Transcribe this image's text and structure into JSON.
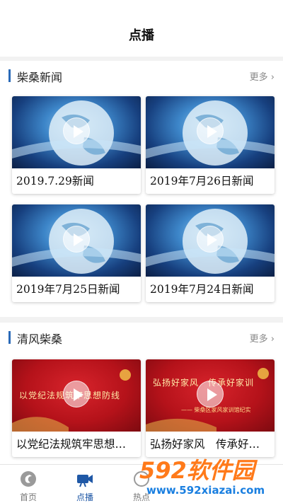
{
  "header": {
    "title": "点播"
  },
  "sections": [
    {
      "title": "柴桑新闻",
      "more": "更多",
      "videos": [
        {
          "caption": "2019.7.29新闻"
        },
        {
          "caption": "2019年7月26日新闻"
        },
        {
          "caption": "2019年7月25日新闻"
        },
        {
          "caption": "2019年7月24日新闻"
        }
      ]
    },
    {
      "title": "清风柴桑",
      "more": "更多",
      "videos": [
        {
          "caption": "以党纪法规筑牢思想…",
          "thumb_text": "以党纪法规筑牢思想防线"
        },
        {
          "caption": "弘扬好家风　传承好…",
          "thumb_text": "弘扬好家风　传承好家训",
          "thumb_sub": "—— 柴桑区家风家训馆纪实"
        }
      ]
    }
  ],
  "tabbar": {
    "tabs": [
      {
        "label": "首页",
        "icon": "home-logo-icon"
      },
      {
        "label": "点播",
        "icon": "video-camera-icon",
        "active": true
      },
      {
        "label": "热点",
        "icon": "hot-icon"
      }
    ]
  },
  "watermark": {
    "brand": "592软件园",
    "url": "www.592xiazai.com"
  },
  "colors": {
    "accent": "#1f58a6",
    "section_bar": "#2a6ab8",
    "watermark_orange": "#ff7a1a",
    "watermark_blue": "#1a7fe0"
  }
}
